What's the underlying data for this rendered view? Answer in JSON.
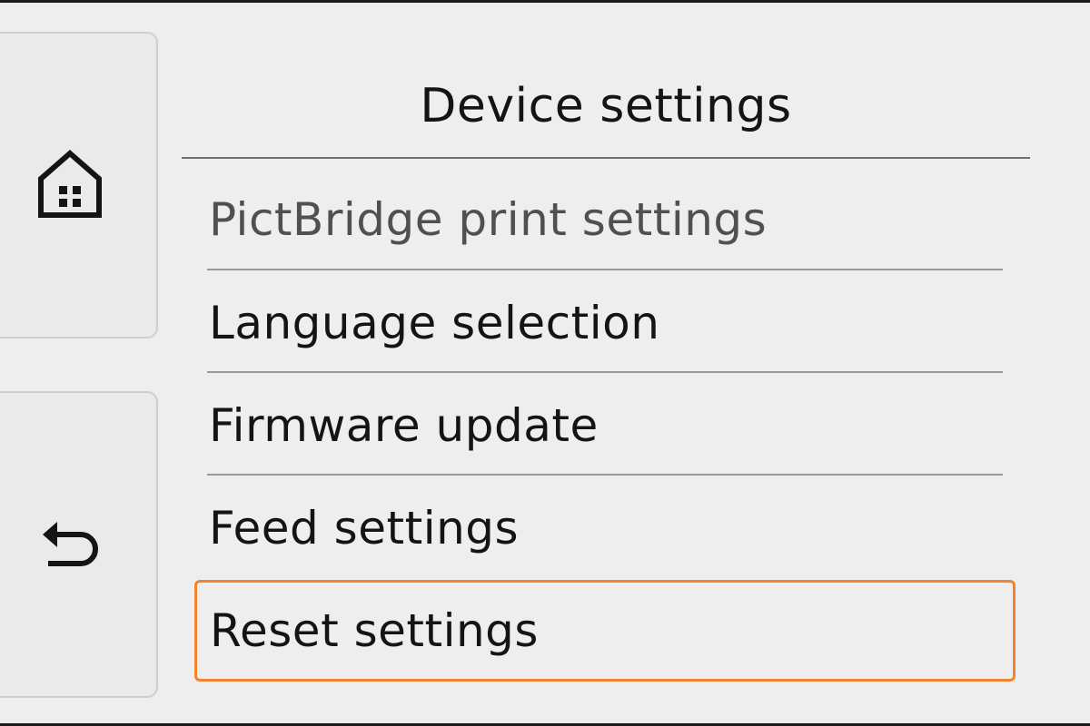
{
  "header": {
    "title": "Device settings"
  },
  "side_buttons": {
    "home_icon": "home-icon",
    "back_icon": "back-icon"
  },
  "menu": {
    "items": [
      {
        "label": "PictBridge print settings",
        "state": "dimmed"
      },
      {
        "label": "Language selection",
        "state": "normal"
      },
      {
        "label": "Firmware update",
        "state": "normal"
      },
      {
        "label": "Feed settings",
        "state": "normal"
      },
      {
        "label": "Reset settings",
        "state": "selected"
      }
    ],
    "selection_color": "#f08432"
  }
}
